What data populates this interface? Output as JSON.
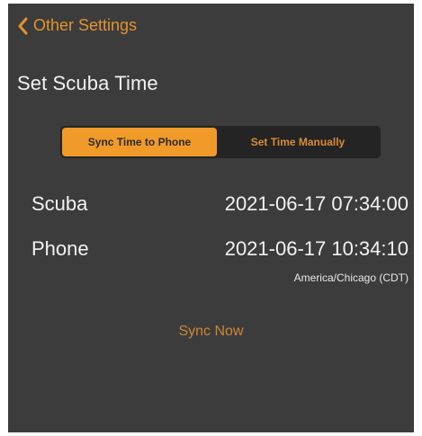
{
  "nav": {
    "back_label": "Other Settings",
    "back_icon": "chevron-left-icon"
  },
  "page": {
    "title": "Set Scuba Time"
  },
  "segmented": {
    "options": [
      {
        "label": "Sync Time to Phone",
        "selected": true
      },
      {
        "label": "Set Time Manually",
        "selected": false
      }
    ]
  },
  "times": {
    "scuba": {
      "label": "Scuba",
      "value": "2021-06-17 07:34:00"
    },
    "phone": {
      "label": "Phone",
      "value": "2021-06-17 10:34:10",
      "timezone": "America/Chicago (CDT)"
    }
  },
  "actions": {
    "sync_now": "Sync Now"
  },
  "colors": {
    "accent": "#f09a2a",
    "accent_text": "#d98b33",
    "background": "#3c3c3c",
    "segment_bg": "#242424",
    "text": "#f2f2f2"
  }
}
